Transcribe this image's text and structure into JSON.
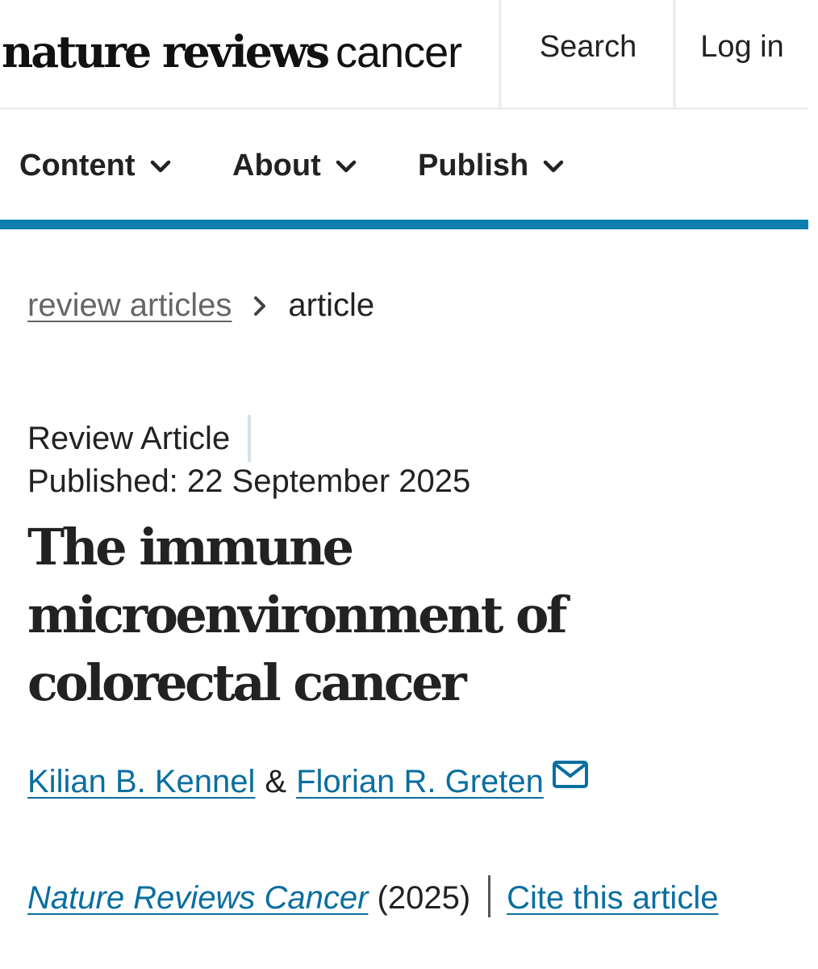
{
  "header": {
    "logo_bold": "nature reviews",
    "logo_light": "cancer",
    "search_label": "Search",
    "login_label": "Log in"
  },
  "nav": {
    "items": [
      {
        "label": "Content",
        "icon": "chevron-down-icon"
      },
      {
        "label": "About",
        "icon": "chevron-down-icon"
      },
      {
        "label": "Publish",
        "icon": "chevron-down-icon"
      }
    ]
  },
  "breadcrumb": {
    "parent": "review articles",
    "separator_icon": "chevron-right-icon",
    "current": "article"
  },
  "article": {
    "type": "Review Article",
    "published": "Published: 22 September 2025",
    "title": "The immune microenvironment of colorectal cancer",
    "authors": [
      "Kilian B. Kennel",
      "Florian R. Greten"
    ],
    "author_separator": "&",
    "contact_icon": "mail-icon",
    "journal": "Nature Reviews Cancer",
    "year": "(2025)",
    "cite_label": "Cite this article"
  },
  "colors": {
    "accent": "#0f7faf",
    "link": "#0a6ea0",
    "text": "#222222",
    "muted": "#666666"
  }
}
